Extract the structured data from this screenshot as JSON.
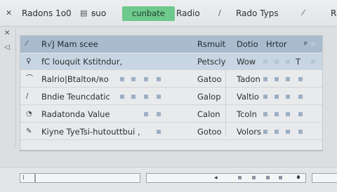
{
  "toolbar": {
    "items": [
      {
        "label": "Radons 1o0"
      },
      {
        "label": "ꞩuo"
      },
      {
        "label": "cunbate"
      },
      {
        "label": "Radio"
      },
      {
        "label": "Rado Typs"
      },
      {
        "label": "R"
      }
    ]
  },
  "table": {
    "header": {
      "name": "R√J Mam scee",
      "result": "Rsmuit",
      "d": "Dotio",
      "h": "Hrtor",
      "extra": "ᵖ"
    },
    "rows": [
      {
        "name": "fC louquit Kstitndur,",
        "result": "Petscly",
        "d": "Wow",
        "t": "T"
      },
      {
        "name": "Ralrio|Btaltoʀ/ʀo",
        "result": "Gatoo",
        "d": "Tadon"
      },
      {
        "name": "Bndie Teuncdatic",
        "result": "Galop",
        "d": "Valtio"
      },
      {
        "name": "Radatonda Value",
        "result": "Calon",
        "d": "Tcoln"
      },
      {
        "name": "Kiyne TyeTsi-hutouttbui ,",
        "result": "Gotoo",
        "d": "Volors"
      }
    ]
  },
  "colors": {
    "accent": "#6dc98c",
    "header": "#a9bccd",
    "selected": "#c8d6e3"
  }
}
